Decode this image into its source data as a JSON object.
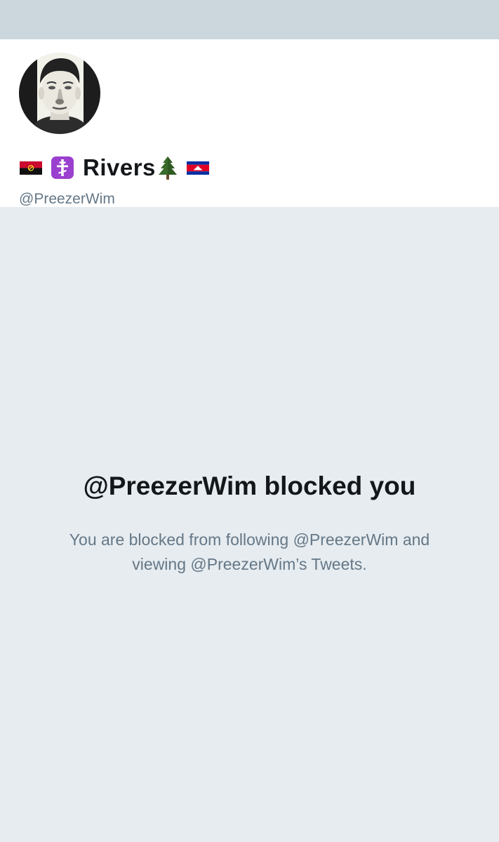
{
  "profile": {
    "display_name": "Rivers",
    "handle": "@PreezerWim",
    "name_icons": [
      "angola-flag-icon",
      "orthodox-cross-icon",
      "evergreen-tree-icon",
      "cambodia-flag-icon"
    ]
  },
  "blocked": {
    "title": "@PreezerWim blocked you",
    "message": "You are blocked from following @PreezerWim and viewing @PreezerWim’s Tweets."
  },
  "colors": {
    "banner": "#ccd6dd",
    "page_background": "#e6ecf0",
    "primary_text": "#14171a",
    "secondary_text": "#657786"
  }
}
